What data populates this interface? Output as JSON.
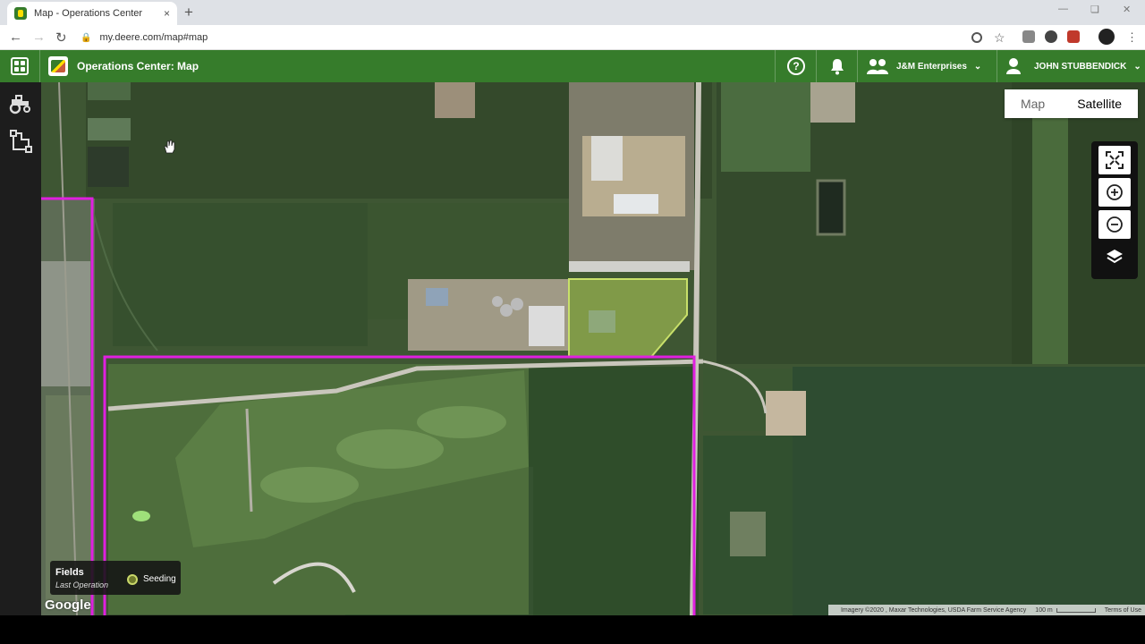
{
  "browser": {
    "tab_title": "Map - Operations Center",
    "tab_close": "×",
    "new_tab": "+",
    "url": "my.deere.com/map#map"
  },
  "header": {
    "title": "Operations Center: Map",
    "help_glyph": "?",
    "organization": "J&M Enterprises",
    "user": "JOHN STUBBENDICK"
  },
  "map": {
    "type_options": [
      "Map",
      "Satellite"
    ],
    "active_type": "Satellite",
    "legend": {
      "title": "Fields",
      "subtitle": "Last Operation",
      "item": "Seeding"
    },
    "provider": "Google",
    "attribution": "Imagery ©2020 , Maxar Technologies, USDA Farm Service Agency",
    "scale": "100 m",
    "terms": "Terms of Use"
  },
  "colors": {
    "header_green": "#367c2b",
    "field_boundary": "#e020e0",
    "seeded_field": "#b6d35a"
  }
}
